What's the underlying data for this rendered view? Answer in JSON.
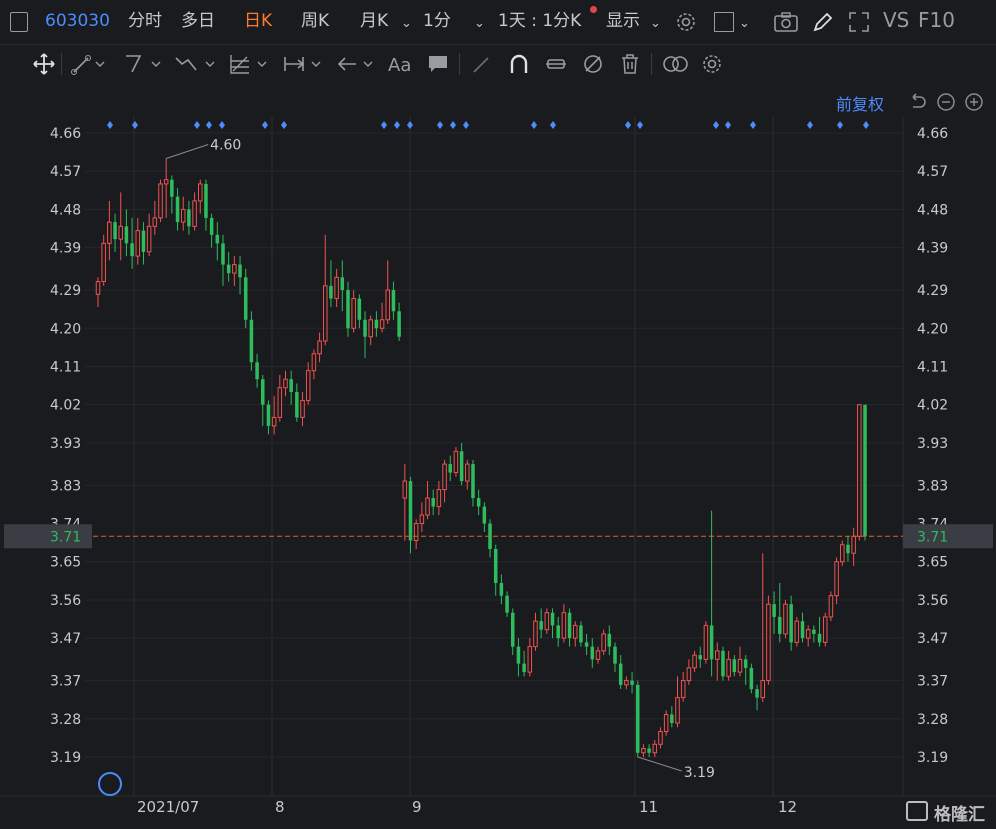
{
  "header": {
    "stock_code": "603030",
    "tabs": [
      "分时",
      "多日",
      "日K",
      "周K",
      "月K"
    ],
    "active_tab": "日K",
    "period": "1分",
    "interval": "1天 : 1分K",
    "display": "显示",
    "vs": "VS",
    "f10": "F10"
  },
  "chart_header": {
    "adjust": "前复权"
  },
  "colors": {
    "up": "#ef5350",
    "down": "#2ebd5d",
    "accent": "#4c8cff",
    "price_line": "#e0652a",
    "active_tab": "#ff7a2f"
  },
  "chart_data": {
    "type": "candlestick",
    "x_ticks": [
      "2021/07",
      "8",
      "9",
      "11",
      "12"
    ],
    "y_ticks": [
      "4.66",
      "4.57",
      "4.48",
      "4.39",
      "4.29",
      "4.20",
      "4.11",
      "4.02",
      "3.93",
      "3.83",
      "3.74",
      "3.65",
      "3.56",
      "3.47",
      "3.37",
      "3.28",
      "3.19"
    ],
    "ylim": [
      3.15,
      4.68
    ],
    "current_price": "3.71",
    "high_label": "4.60",
    "low_label": "3.19",
    "candles": [
      [
        4.28,
        4.31,
        4.25,
        4.32
      ],
      [
        4.31,
        4.4,
        4.3,
        4.42
      ],
      [
        4.4,
        4.45,
        4.36,
        4.5
      ],
      [
        4.45,
        4.41,
        4.38,
        4.47
      ],
      [
        4.41,
        4.44,
        4.36,
        4.52
      ],
      [
        4.44,
        4.4,
        4.37,
        4.48
      ],
      [
        4.4,
        4.37,
        4.34,
        4.46
      ],
      [
        4.37,
        4.43,
        4.35,
        4.46
      ],
      [
        4.43,
        4.38,
        4.35,
        4.45
      ],
      [
        4.38,
        4.44,
        4.37,
        4.47
      ],
      [
        4.44,
        4.46,
        4.42,
        4.5
      ],
      [
        4.46,
        4.54,
        4.45,
        4.55
      ],
      [
        4.54,
        4.55,
        4.46,
        4.6
      ],
      [
        4.55,
        4.51,
        4.47,
        4.56
      ],
      [
        4.51,
        4.45,
        4.43,
        4.53
      ],
      [
        4.45,
        4.48,
        4.43,
        4.51
      ],
      [
        4.48,
        4.44,
        4.42,
        4.5
      ],
      [
        4.44,
        4.5,
        4.43,
        4.52
      ],
      [
        4.5,
        4.54,
        4.47,
        4.55
      ],
      [
        4.54,
        4.46,
        4.43,
        4.55
      ],
      [
        4.46,
        4.42,
        4.39,
        4.47
      ],
      [
        4.42,
        4.4,
        4.36,
        4.45
      ],
      [
        4.4,
        4.35,
        4.3,
        4.42
      ],
      [
        4.35,
        4.33,
        4.31,
        4.38
      ],
      [
        4.33,
        4.35,
        4.3,
        4.37
      ],
      [
        4.35,
        4.32,
        4.28,
        4.37
      ],
      [
        4.32,
        4.22,
        4.2,
        4.34
      ],
      [
        4.22,
        4.12,
        4.1,
        4.24
      ],
      [
        4.12,
        4.08,
        4.06,
        4.14
      ],
      [
        4.08,
        4.02,
        3.97,
        4.09
      ],
      [
        4.02,
        3.97,
        3.95,
        4.03
      ],
      [
        3.97,
        3.99,
        3.95,
        4.04
      ],
      [
        3.99,
        4.06,
        3.98,
        4.09
      ],
      [
        4.06,
        4.08,
        4.04,
        4.1
      ],
      [
        4.08,
        4.05,
        4.02,
        4.1
      ],
      [
        4.05,
        3.99,
        3.98,
        4.07
      ],
      [
        3.99,
        4.03,
        3.97,
        4.05
      ],
      [
        4.03,
        4.1,
        4.02,
        4.12
      ],
      [
        4.1,
        4.14,
        4.08,
        4.15
      ],
      [
        4.14,
        4.17,
        4.12,
        4.19
      ],
      [
        4.17,
        4.3,
        4.16,
        4.42
      ],
      [
        4.3,
        4.27,
        4.25,
        4.36
      ],
      [
        4.27,
        4.32,
        4.25,
        4.34
      ],
      [
        4.32,
        4.29,
        4.24,
        4.36
      ],
      [
        4.29,
        4.2,
        4.18,
        4.31
      ],
      [
        4.2,
        4.27,
        4.19,
        4.29
      ],
      [
        4.27,
        4.22,
        4.2,
        4.28
      ],
      [
        4.22,
        4.18,
        4.13,
        4.24
      ],
      [
        4.18,
        4.22,
        4.16,
        4.23
      ],
      [
        4.22,
        4.2,
        4.18,
        4.24
      ],
      [
        4.2,
        4.22,
        4.19,
        4.26
      ],
      [
        4.22,
        4.29,
        4.21,
        4.36
      ],
      [
        4.29,
        4.24,
        4.22,
        4.31
      ],
      [
        4.24,
        4.18,
        4.17,
        4.26
      ],
      [
        3.8,
        3.84,
        3.7,
        3.88
      ],
      [
        3.84,
        3.7,
        3.67,
        3.85
      ],
      [
        3.7,
        3.74,
        3.68,
        3.75
      ],
      [
        3.74,
        3.76,
        3.72,
        3.79
      ],
      [
        3.76,
        3.8,
        3.75,
        3.84
      ],
      [
        3.8,
        3.78,
        3.76,
        3.82
      ],
      [
        3.78,
        3.82,
        3.76,
        3.84
      ],
      [
        3.82,
        3.88,
        3.79,
        3.89
      ],
      [
        3.88,
        3.86,
        3.84,
        3.9
      ],
      [
        3.86,
        3.91,
        3.85,
        3.92
      ],
      [
        3.91,
        3.84,
        3.83,
        3.93
      ],
      [
        3.84,
        3.88,
        3.82,
        3.89
      ],
      [
        3.88,
        3.8,
        3.78,
        3.89
      ],
      [
        3.8,
        3.78,
        3.76,
        3.82
      ],
      [
        3.78,
        3.74,
        3.72,
        3.79
      ],
      [
        3.74,
        3.68,
        3.66,
        3.75
      ],
      [
        3.68,
        3.6,
        3.57,
        3.69
      ],
      [
        3.6,
        3.57,
        3.55,
        3.62
      ],
      [
        3.57,
        3.53,
        3.52,
        3.58
      ],
      [
        3.53,
        3.45,
        3.43,
        3.54
      ],
      [
        3.45,
        3.41,
        3.38,
        3.47
      ],
      [
        3.41,
        3.39,
        3.38,
        3.44
      ],
      [
        3.39,
        3.45,
        3.38,
        3.47
      ],
      [
        3.45,
        3.51,
        3.44,
        3.53
      ],
      [
        3.51,
        3.49,
        3.47,
        3.54
      ],
      [
        3.49,
        3.53,
        3.48,
        3.54
      ],
      [
        3.53,
        3.5,
        3.47,
        3.54
      ],
      [
        3.5,
        3.47,
        3.45,
        3.52
      ],
      [
        3.47,
        3.53,
        3.46,
        3.55
      ],
      [
        3.53,
        3.47,
        3.45,
        3.54
      ],
      [
        3.47,
        3.5,
        3.45,
        3.51
      ],
      [
        3.5,
        3.46,
        3.45,
        3.51
      ],
      [
        3.46,
        3.45,
        3.43,
        3.48
      ],
      [
        3.45,
        3.42,
        3.4,
        3.47
      ],
      [
        3.42,
        3.44,
        3.41,
        3.45
      ],
      [
        3.44,
        3.48,
        3.43,
        3.49
      ],
      [
        3.48,
        3.45,
        3.43,
        3.5
      ],
      [
        3.45,
        3.41,
        3.39,
        3.46
      ],
      [
        3.41,
        3.36,
        3.35,
        3.43
      ],
      [
        3.36,
        3.37,
        3.35,
        3.38
      ],
      [
        3.37,
        3.36,
        3.34,
        3.39
      ],
      [
        3.36,
        3.2,
        3.19,
        3.37
      ],
      [
        3.2,
        3.21,
        3.19,
        3.22
      ],
      [
        3.21,
        3.2,
        3.19,
        3.22
      ],
      [
        3.2,
        3.22,
        3.19,
        3.23
      ],
      [
        3.22,
        3.25,
        3.21,
        3.26
      ],
      [
        3.25,
        3.29,
        3.24,
        3.3
      ],
      [
        3.29,
        3.27,
        3.26,
        3.31
      ],
      [
        3.27,
        3.33,
        3.26,
        3.38
      ],
      [
        3.33,
        3.37,
        3.32,
        3.39
      ],
      [
        3.37,
        3.4,
        3.36,
        3.42
      ],
      [
        3.4,
        3.43,
        3.39,
        3.44
      ],
      [
        3.43,
        3.42,
        3.4,
        3.45
      ],
      [
        3.42,
        3.5,
        3.41,
        3.51
      ],
      [
        3.5,
        3.42,
        3.38,
        3.77
      ],
      [
        3.42,
        3.44,
        3.37,
        3.46
      ],
      [
        3.44,
        3.38,
        3.37,
        3.45
      ],
      [
        3.38,
        3.42,
        3.37,
        3.44
      ],
      [
        3.42,
        3.39,
        3.38,
        3.43
      ],
      [
        3.39,
        3.42,
        3.38,
        3.45
      ],
      [
        3.42,
        3.4,
        3.36,
        3.43
      ],
      [
        3.4,
        3.35,
        3.34,
        3.41
      ],
      [
        3.35,
        3.33,
        3.3,
        3.36
      ],
      [
        3.33,
        3.37,
        3.32,
        3.67
      ],
      [
        3.37,
        3.55,
        3.36,
        3.57
      ],
      [
        3.55,
        3.52,
        3.48,
        3.58
      ],
      [
        3.52,
        3.48,
        3.46,
        3.6
      ],
      [
        3.48,
        3.55,
        3.47,
        3.56
      ],
      [
        3.55,
        3.46,
        3.44,
        3.57
      ],
      [
        3.46,
        3.51,
        3.45,
        3.52
      ],
      [
        3.51,
        3.47,
        3.46,
        3.53
      ],
      [
        3.47,
        3.49,
        3.45,
        3.5
      ],
      [
        3.49,
        3.48,
        3.46,
        3.5
      ],
      [
        3.48,
        3.46,
        3.45,
        3.52
      ],
      [
        3.46,
        3.52,
        3.45,
        3.53
      ],
      [
        3.52,
        3.57,
        3.51,
        3.58
      ],
      [
        3.57,
        3.65,
        3.55,
        3.66
      ],
      [
        3.65,
        3.69,
        3.64,
        3.7
      ],
      [
        3.69,
        3.67,
        3.65,
        3.71
      ],
      [
        3.67,
        3.71,
        3.64,
        3.73
      ],
      [
        3.71,
        4.02,
        3.7,
        4.02
      ],
      [
        4.02,
        3.71,
        3.7,
        3.96
      ]
    ]
  }
}
